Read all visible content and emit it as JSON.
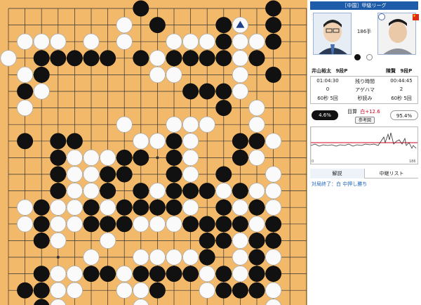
{
  "header": {
    "title": "［中国］甲級リーグ"
  },
  "players": {
    "black": {
      "name": "井山裕太",
      "rank": "9段P",
      "time_remaining": "01:04:30",
      "captures": "0",
      "byoyomi": "60秒 5回",
      "flag": "japan"
    },
    "white": {
      "name": "陳賢",
      "rank": "9段P",
      "time_remaining": "00:44:45",
      "captures": "2",
      "byoyomi": "60秒 5回",
      "flag": "china"
    }
  },
  "move_count": "186手",
  "time_labels": {
    "remaining": "残り時間",
    "captures": "アゲハマ",
    "byoyomi": "秒読み"
  },
  "score": {
    "black_win_rate": "4.6%",
    "white_win_rate": "95.4%",
    "estimate_label": "目算",
    "estimate_value": "白+12.6",
    "reference_button": "参考図"
  },
  "graph": {
    "x_start": "0",
    "x_end": "186"
  },
  "tabs": {
    "commentary": "解説",
    "broadcast_list": "中継リスト"
  },
  "commentary_text": "対局終了：白 中押し勝ち",
  "colors": {
    "board": "#f2b96b",
    "header": "#1e5ba8",
    "black_bar": "#111111",
    "comment": "#2266bb"
  },
  "board": {
    "size": 19,
    "black": [
      [
        0,
        8
      ],
      [
        0,
        16
      ],
      [
        1,
        9
      ],
      [
        1,
        13
      ],
      [
        1,
        16
      ],
      [
        2,
        13
      ],
      [
        2,
        16
      ],
      [
        3,
        2
      ],
      [
        3,
        3
      ],
      [
        3,
        4
      ],
      [
        3,
        5
      ],
      [
        3,
        6
      ],
      [
        3,
        8
      ],
      [
        3,
        10
      ],
      [
        3,
        11
      ],
      [
        3,
        12
      ],
      [
        3,
        13
      ],
      [
        3,
        15
      ],
      [
        4,
        2
      ],
      [
        4,
        16
      ],
      [
        5,
        1
      ],
      [
        5,
        11
      ],
      [
        5,
        12
      ],
      [
        5,
        13
      ],
      [
        6,
        13
      ],
      [
        8,
        1
      ],
      [
        8,
        3
      ],
      [
        8,
        4
      ],
      [
        8,
        10
      ],
      [
        8,
        14
      ],
      [
        8,
        15
      ],
      [
        9,
        3
      ],
      [
        9,
        7
      ],
      [
        9,
        8
      ],
      [
        9,
        10
      ],
      [
        9,
        14
      ],
      [
        10,
        3
      ],
      [
        10,
        6
      ],
      [
        10,
        7
      ],
      [
        10,
        10
      ],
      [
        10,
        13
      ],
      [
        11,
        3
      ],
      [
        11,
        6
      ],
      [
        11,
        8
      ],
      [
        11,
        10
      ],
      [
        11,
        11
      ],
      [
        11,
        12
      ],
      [
        11,
        14
      ],
      [
        12,
        2
      ],
      [
        12,
        5
      ],
      [
        12,
        7
      ],
      [
        12,
        8
      ],
      [
        12,
        9
      ],
      [
        12,
        10
      ],
      [
        12,
        13
      ],
      [
        12,
        15
      ],
      [
        13,
        2
      ],
      [
        13,
        5
      ],
      [
        13,
        6
      ],
      [
        13,
        7
      ],
      [
        13,
        11
      ],
      [
        13,
        12
      ],
      [
        13,
        13
      ],
      [
        13,
        14
      ],
      [
        13,
        16
      ],
      [
        14,
        2
      ],
      [
        14,
        12
      ],
      [
        14,
        13
      ],
      [
        14,
        15
      ],
      [
        14,
        16
      ],
      [
        15,
        12
      ],
      [
        15,
        15
      ],
      [
        16,
        2
      ],
      [
        16,
        5
      ],
      [
        16,
        6
      ],
      [
        16,
        8
      ],
      [
        16,
        9
      ],
      [
        16,
        10
      ],
      [
        16,
        11
      ],
      [
        16,
        13
      ],
      [
        16,
        15
      ],
      [
        16,
        16
      ],
      [
        17,
        1
      ],
      [
        17,
        2
      ],
      [
        17,
        9
      ],
      [
        17,
        13
      ],
      [
        17,
        14
      ],
      [
        17,
        15
      ],
      [
        18,
        2
      ]
    ],
    "white": [
      [
        1,
        7
      ],
      [
        2,
        1
      ],
      [
        2,
        2
      ],
      [
        2,
        3
      ],
      [
        2,
        5
      ],
      [
        2,
        7
      ],
      [
        2,
        10
      ],
      [
        2,
        11
      ],
      [
        2,
        12
      ],
      [
        2,
        14
      ],
      [
        2,
        15
      ],
      [
        3,
        0
      ],
      [
        3,
        9
      ],
      [
        3,
        14
      ],
      [
        4,
        1
      ],
      [
        4,
        9
      ],
      [
        4,
        10
      ],
      [
        4,
        14
      ],
      [
        5,
        2
      ],
      [
        5,
        14
      ],
      [
        6,
        1
      ],
      [
        6,
        15
      ],
      [
        7,
        7
      ],
      [
        7,
        10
      ],
      [
        7,
        11
      ],
      [
        7,
        12
      ],
      [
        7,
        15
      ],
      [
        8,
        8
      ],
      [
        8,
        9
      ],
      [
        8,
        11
      ],
      [
        8,
        16
      ],
      [
        9,
        4
      ],
      [
        9,
        5
      ],
      [
        9,
        6
      ],
      [
        9,
        11
      ],
      [
        9,
        15
      ],
      [
        10,
        4
      ],
      [
        10,
        5
      ],
      [
        10,
        11
      ],
      [
        10,
        16
      ],
      [
        11,
        4
      ],
      [
        11,
        5
      ],
      [
        11,
        9
      ],
      [
        11,
        13
      ],
      [
        11,
        15
      ],
      [
        11,
        16
      ],
      [
        12,
        1
      ],
      [
        12,
        3
      ],
      [
        12,
        4
      ],
      [
        12,
        6
      ],
      [
        12,
        11
      ],
      [
        12,
        14
      ],
      [
        12,
        16
      ],
      [
        13,
        1
      ],
      [
        13,
        3
      ],
      [
        13,
        4
      ],
      [
        13,
        8
      ],
      [
        13,
        9
      ],
      [
        13,
        10
      ],
      [
        13,
        15
      ],
      [
        14,
        3
      ],
      [
        14,
        6
      ],
      [
        14,
        14
      ],
      [
        15,
        5
      ],
      [
        15,
        8
      ],
      [
        15,
        9
      ],
      [
        15,
        10
      ],
      [
        15,
        11
      ],
      [
        15,
        14
      ],
      [
        15,
        16
      ],
      [
        16,
        3
      ],
      [
        16,
        4
      ],
      [
        16,
        7
      ],
      [
        16,
        12
      ],
      [
        16,
        14
      ],
      [
        17,
        3
      ],
      [
        17,
        4
      ],
      [
        17,
        7
      ],
      [
        17,
        8
      ],
      [
        17,
        12
      ],
      [
        17,
        16
      ],
      [
        18,
        3
      ],
      [
        18,
        8
      ],
      [
        18,
        16
      ]
    ],
    "last_move": [
      1,
      14
    ]
  }
}
